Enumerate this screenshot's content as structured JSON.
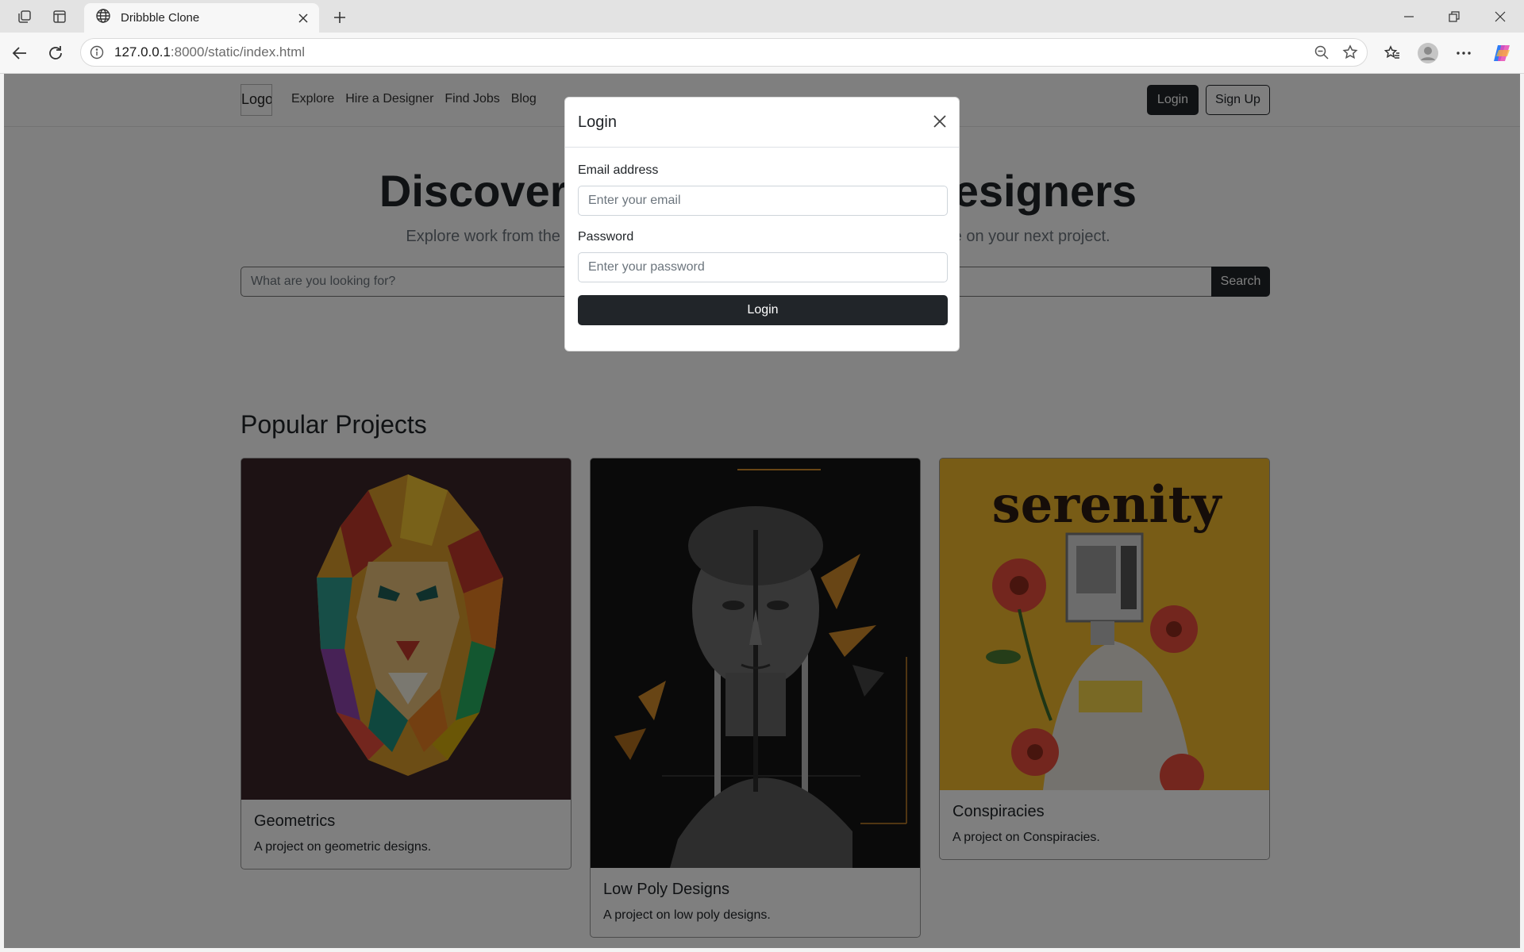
{
  "browser": {
    "tab_title": "Dribbble Clone",
    "url_host": "127.0.0.1",
    "url_rest": ":8000/static/index.html"
  },
  "site": {
    "logo_alt": "Logo",
    "nav": [
      "Explore",
      "Hire a Designer",
      "Find Jobs",
      "Blog"
    ],
    "login_label": "Login",
    "signup_label": "Sign Up",
    "hero_title": "Discover the World's Top Designers",
    "hero_subtitle": "Explore work from the most talented and accomplished designers ready to take on your next project.",
    "search_placeholder": "What are you looking for?",
    "search_button": "Search",
    "section_title": "Popular Projects",
    "projects": [
      {
        "title": "Geometrics",
        "description": "A project on geometric designs."
      },
      {
        "title": "Low Poly Designs",
        "description": "A project on low poly designs."
      },
      {
        "title": "Conspiracies",
        "description": "A project on Conspiracies.",
        "art_text": "serenity"
      }
    ]
  },
  "modal": {
    "title": "Login",
    "email_label": "Email address",
    "email_placeholder": "Enter your email",
    "password_label": "Password",
    "password_placeholder": "Enter your password",
    "submit_label": "Login"
  }
}
